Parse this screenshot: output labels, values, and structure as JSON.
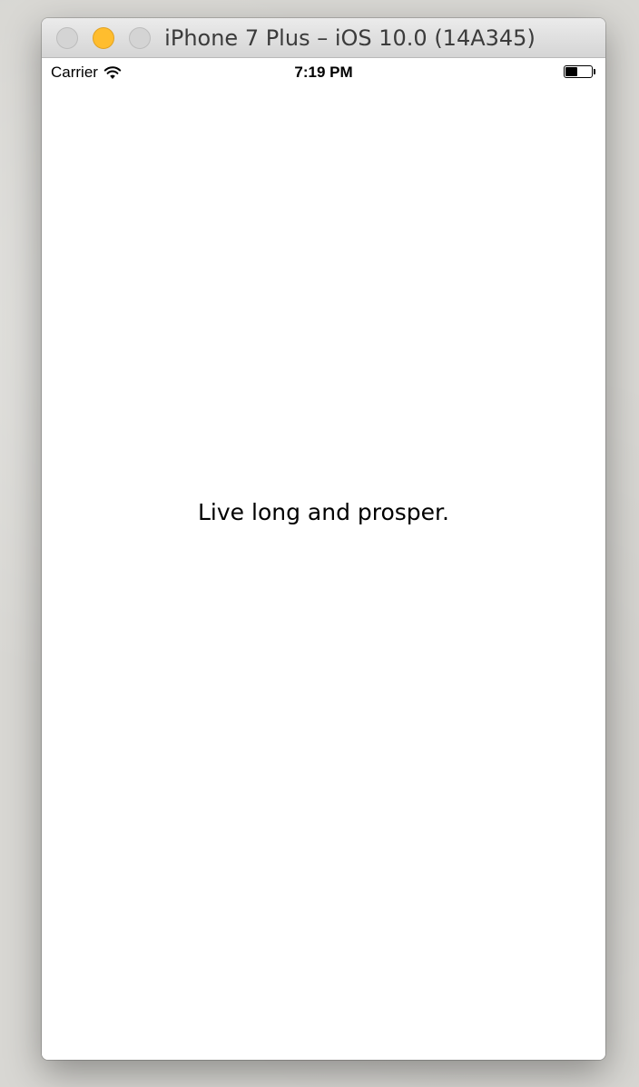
{
  "window": {
    "title": "iPhone 7 Plus – iOS 10.0 (14A345)",
    "controls": [
      "close",
      "minimize",
      "zoom"
    ],
    "minimize_color": "#ffbd2e"
  },
  "status_bar": {
    "carrier": "Carrier",
    "wifi_icon": "wifi-icon",
    "time": "7:19 PM",
    "battery_level": 0.45
  },
  "main": {
    "label": "Live long and prosper."
  }
}
